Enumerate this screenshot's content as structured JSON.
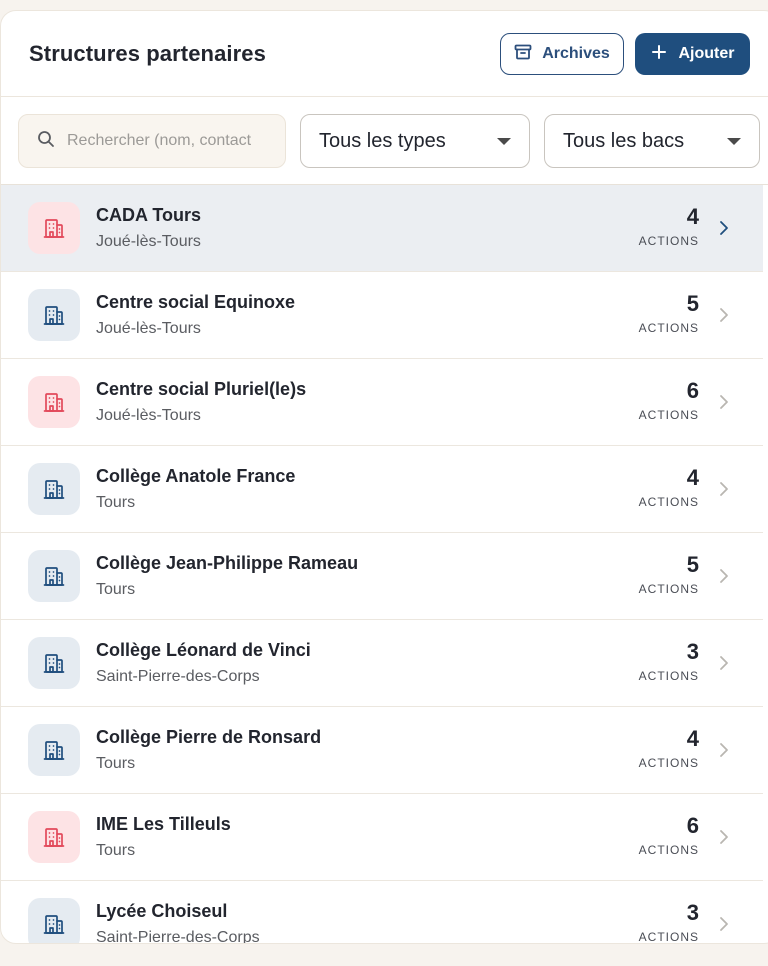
{
  "header": {
    "title": "Structures partenaires",
    "archives_label": "Archives",
    "add_label": "Ajouter"
  },
  "filters": {
    "search_placeholder": "Rechercher (nom, contact",
    "type_selected": "Tous les types",
    "bac_selected": "Tous les bacs"
  },
  "colors": {
    "primary": "#1f4e7e",
    "red_icon": "#e2495b",
    "blue_icon": "#1f4e7e",
    "active_row": "#ebeef2"
  },
  "count_label": "ACTIONS",
  "rows": [
    {
      "name": "CADA Tours",
      "city": "Joué-lès-Tours",
      "count": "4",
      "icon": "building-icon",
      "tone": "red"
    },
    {
      "name": "Centre social Equinoxe",
      "city": "Joué-lès-Tours",
      "count": "5",
      "icon": "building-icon",
      "tone": "blue"
    },
    {
      "name": "Centre social Pluriel(le)s",
      "city": "Joué-lès-Tours",
      "count": "6",
      "icon": "building-icon",
      "tone": "red"
    },
    {
      "name": "Collège Anatole France",
      "city": "Tours",
      "count": "4",
      "icon": "building-icon",
      "tone": "blue"
    },
    {
      "name": "Collège Jean-Philippe Rameau",
      "city": "Tours",
      "count": "5",
      "icon": "building-icon",
      "tone": "blue"
    },
    {
      "name": "Collège Léonard de Vinci",
      "city": "Saint-Pierre-des-Corps",
      "count": "3",
      "icon": "building-icon",
      "tone": "blue"
    },
    {
      "name": "Collège Pierre de Ronsard",
      "city": "Tours",
      "count": "4",
      "icon": "building-icon",
      "tone": "blue"
    },
    {
      "name": "IME Les Tilleuls",
      "city": "Tours",
      "count": "6",
      "icon": "building-icon",
      "tone": "red"
    },
    {
      "name": "Lycée Choiseul",
      "city": "Saint-Pierre-des-Corps",
      "count": "3",
      "icon": "building-icon",
      "tone": "blue"
    }
  ]
}
